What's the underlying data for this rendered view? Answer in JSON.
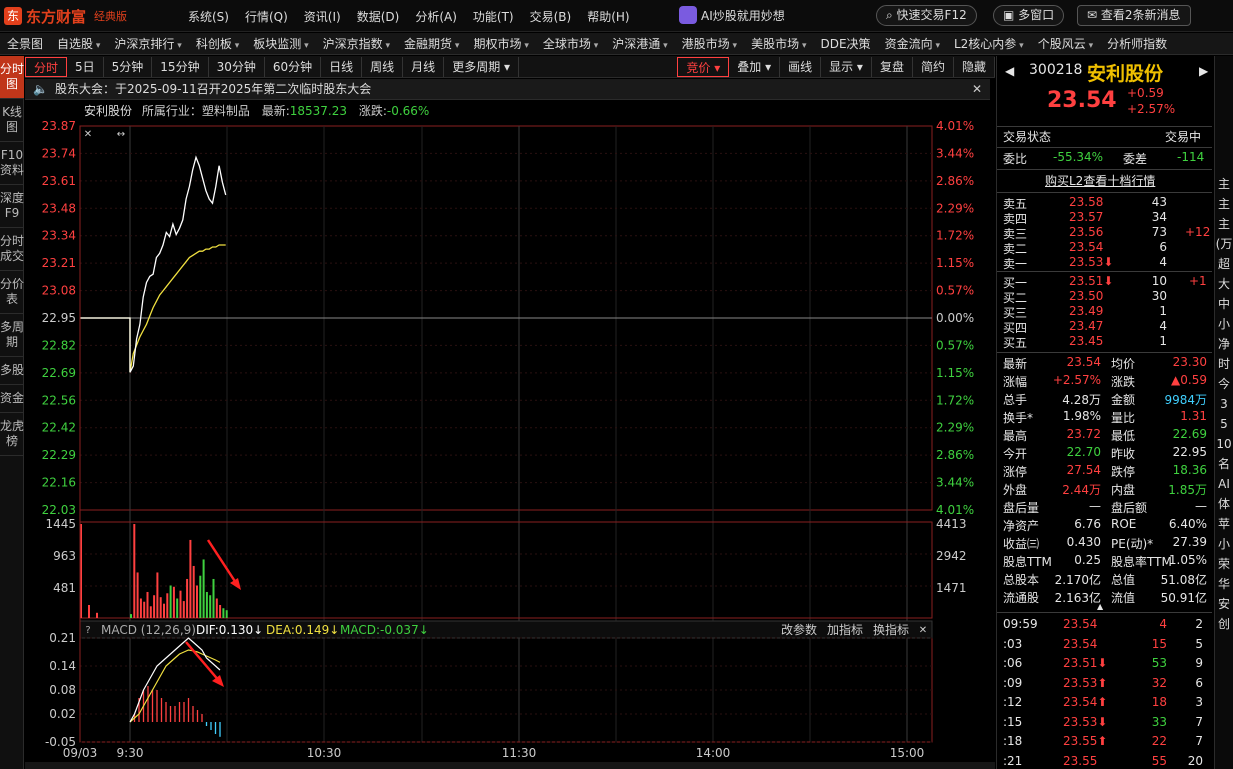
{
  "app": {
    "name": "东方财富",
    "edition": "经典版",
    "menu": [
      "系统(S)",
      "行情(Q)",
      "资讯(I)",
      "数据(D)",
      "分析(A)",
      "功能(T)",
      "交易(B)",
      "帮助(H)"
    ],
    "ai_label": "AI炒股就用妙想",
    "quick_trade": "快速交易F12",
    "multi_window": "多窗口",
    "messages": "查看2条新消息"
  },
  "nav": {
    "items": [
      "全景图",
      "自选股",
      "沪深京排行",
      "科创板",
      "板块监测",
      "沪深京指数",
      "金融期货",
      "期权市场",
      "全球市场",
      "沪深港通",
      "港股市场",
      "美股市场",
      "DDE决策",
      "资金流向",
      "L2核心内参",
      "个股风云",
      "分析师指数"
    ],
    "arrows": [
      false,
      true,
      true,
      true,
      true,
      true,
      true,
      true,
      true,
      true,
      true,
      true,
      false,
      true,
      true,
      true,
      false
    ]
  },
  "sidebar": [
    "分时图",
    "K线图",
    "F10资料",
    "深度F9",
    "分时成交",
    "分价表",
    "多周期",
    "多股",
    "资金",
    "龙虎榜"
  ],
  "toolbar": {
    "left": [
      "分时",
      "5日",
      "5分钟",
      "15分钟",
      "30分钟",
      "60分钟",
      "日线",
      "周线",
      "月线",
      "更多周期"
    ],
    "right": [
      "竞价",
      "叠加",
      "画线",
      "显示",
      "复盘",
      "简约",
      "隐藏"
    ]
  },
  "notice": "股东大会：于2025-09-11召开2025年第二次临时股东大会",
  "subheader": {
    "name": "安利股份",
    "industry": "所属行业：塑料制品",
    "latest_label": "最新:",
    "latest": "18537.23",
    "chg_label": "涨跌:",
    "chg": "-0.66%"
  },
  "price_axis": {
    "left": [
      "23.87",
      "23.74",
      "23.61",
      "23.48",
      "23.34",
      "23.21",
      "23.08",
      "22.95",
      "22.82",
      "22.69",
      "22.56",
      "22.42",
      "22.29",
      "22.16",
      "22.03"
    ],
    "right": [
      "4.01%",
      "3.44%",
      "2.86%",
      "2.29%",
      "1.72%",
      "1.15%",
      "0.57%",
      "0.00%",
      "0.57%",
      "1.15%",
      "1.72%",
      "2.29%",
      "2.86%",
      "3.44%",
      "4.01%"
    ]
  },
  "volume_axis": {
    "left": [
      "1445",
      "963",
      "481"
    ],
    "right": [
      "4413",
      "2942",
      "1471"
    ]
  },
  "macd": {
    "label": "MACD (12,26,9)",
    "dif": "DIF:0.130",
    "dea": "DEA:0.149",
    "macd": "MACD:-0.037",
    "buttons": [
      "改参数",
      "加指标",
      "换指标"
    ],
    "axis": [
      "0.21",
      "0.14",
      "0.08",
      "0.02",
      "-0.05"
    ]
  },
  "time_axis": [
    "09/03",
    "9:30",
    "10:30",
    "11:30",
    "14:00",
    "15:00"
  ],
  "chart_data": {
    "type": "line",
    "x_axis": "time",
    "prev_close": 22.95,
    "price": [
      22.95,
      22.95,
      22.95,
      22.69,
      22.72,
      22.85,
      22.92,
      23.05,
      23.12,
      23.15,
      23.16,
      23.24,
      23.26,
      23.3,
      23.36,
      23.34,
      23.4,
      23.35,
      23.38,
      23.42,
      23.52,
      23.58,
      23.66,
      23.72,
      23.68,
      23.62,
      23.56,
      23.52,
      23.5,
      23.58,
      23.68,
      23.6,
      23.54
    ],
    "avg": [
      22.95,
      22.95,
      22.95,
      22.69,
      22.78,
      22.82,
      22.86,
      22.89,
      22.92,
      22.96,
      23.0,
      23.03,
      23.06,
      23.08,
      23.1,
      23.12,
      23.14,
      23.16,
      23.18,
      23.2,
      23.22,
      23.24,
      23.25,
      23.26,
      23.27,
      23.27,
      23.28,
      23.28,
      23.29,
      23.29,
      23.3,
      23.3,
      23.3
    ],
    "volume": [
      1445,
      200,
      80,
      60,
      1445,
      700,
      300,
      250,
      400,
      180,
      350,
      700,
      320,
      220,
      380,
      500,
      480,
      300,
      420,
      260,
      600,
      1200,
      800,
      500,
      650,
      900,
      400,
      350,
      600,
      300,
      200,
      150,
      120
    ],
    "macd_dif": [
      0,
      0,
      0,
      0,
      0.02,
      0.05,
      0.08,
      0.1,
      0.12,
      0.14,
      0.15,
      0.16,
      0.17,
      0.18,
      0.19,
      0.2,
      0.21,
      0.2,
      0.19,
      0.18,
      0.16,
      0.15,
      0.14,
      0.13
    ],
    "macd_dea": [
      0,
      0,
      0,
      0,
      0.01,
      0.02,
      0.04,
      0.06,
      0.08,
      0.1,
      0.12,
      0.14,
      0.15,
      0.16,
      0.17,
      0.175,
      0.18,
      0.178,
      0.175,
      0.17,
      0.165,
      0.16,
      0.155,
      0.149
    ],
    "macd_hist": [
      0,
      0,
      0,
      0,
      0.02,
      0.06,
      0.08,
      0.09,
      0.08,
      0.08,
      0.06,
      0.05,
      0.04,
      0.04,
      0.05,
      0.05,
      0.06,
      0.04,
      0.03,
      0.02,
      -0.01,
      -0.02,
      -0.03,
      -0.037
    ]
  },
  "quote": {
    "code": "300218",
    "name": "安利股份",
    "price": "23.54",
    "chg": "+0.59",
    "chg_pct": "+2.57%",
    "status_label": "交易状态",
    "status": "交易中",
    "weibi_label": "委比",
    "weibi": "-55.34%",
    "weicha_label": "委差",
    "weicha": "-114",
    "l2_link": "购买L2查看十档行情",
    "asks": [
      {
        "l": "卖五",
        "p": "23.58",
        "v": "43",
        "d": ""
      },
      {
        "l": "卖四",
        "p": "23.57",
        "v": "34",
        "d": ""
      },
      {
        "l": "卖三",
        "p": "23.56",
        "v": "73",
        "d": "+12"
      },
      {
        "l": "卖二",
        "p": "23.54",
        "v": "6",
        "d": ""
      },
      {
        "l": "卖一",
        "p": "23.53",
        "v": "4",
        "d": ""
      }
    ],
    "bids": [
      {
        "l": "买一",
        "p": "23.51",
        "v": "10",
        "d": "+1"
      },
      {
        "l": "买二",
        "p": "23.50",
        "v": "30",
        "d": ""
      },
      {
        "l": "买三",
        "p": "23.49",
        "v": "1",
        "d": ""
      },
      {
        "l": "买四",
        "p": "23.47",
        "v": "4",
        "d": ""
      },
      {
        "l": "买五",
        "p": "23.45",
        "v": "1",
        "d": ""
      }
    ],
    "stats": [
      [
        "最新",
        "23.54",
        "均价",
        "23.30"
      ],
      [
        "涨幅",
        "+2.57%",
        "涨跌",
        "▲0.59"
      ],
      [
        "总手",
        "4.28万",
        "金额",
        "9984万"
      ],
      [
        "换手*",
        "1.98%",
        "量比",
        "1.31"
      ],
      [
        "最高",
        "23.72",
        "最低",
        "22.69"
      ],
      [
        "今开",
        "22.70",
        "昨收",
        "22.95"
      ],
      [
        "涨停",
        "27.54",
        "跌停",
        "18.36"
      ],
      [
        "外盘",
        "2.44万",
        "内盘",
        "1.85万"
      ],
      [
        "盘后量",
        "—",
        "盘后额",
        "—"
      ],
      [
        "净资产",
        "6.76",
        "ROE",
        "6.40%"
      ],
      [
        "收益㈢",
        "0.430",
        "PE(动)*",
        "27.39"
      ],
      [
        "股息TTM",
        "0.25",
        "股息率TTM",
        "1.05%"
      ],
      [
        "总股本",
        "2.170亿",
        "总值",
        "51.08亿"
      ],
      [
        "流通股",
        "2.163亿",
        "流值",
        "50.91亿"
      ]
    ],
    "ticks": [
      [
        "09:59",
        "23.54",
        "",
        "4",
        "2"
      ],
      [
        ":03",
        "23.54",
        "",
        "15",
        "5"
      ],
      [
        ":06",
        "23.51",
        "down",
        "53",
        "9"
      ],
      [
        ":09",
        "23.53",
        "up",
        "32",
        "6"
      ],
      [
        ":12",
        "23.54",
        "up",
        "18",
        "3"
      ],
      [
        ":15",
        "23.53",
        "down",
        "33",
        "7"
      ],
      [
        ":18",
        "23.55",
        "up",
        "22",
        "7"
      ],
      [
        ":21",
        "23.55",
        "",
        "55",
        "20"
      ]
    ]
  },
  "edge": [
    "主",
    "主",
    "主",
    "(万",
    "超",
    "大",
    "中",
    "小",
    "净",
    "时",
    "今",
    "3",
    "5",
    "10",
    "名",
    "AI",
    "体",
    "苹",
    "小",
    "荣",
    "华",
    "安",
    "创"
  ]
}
